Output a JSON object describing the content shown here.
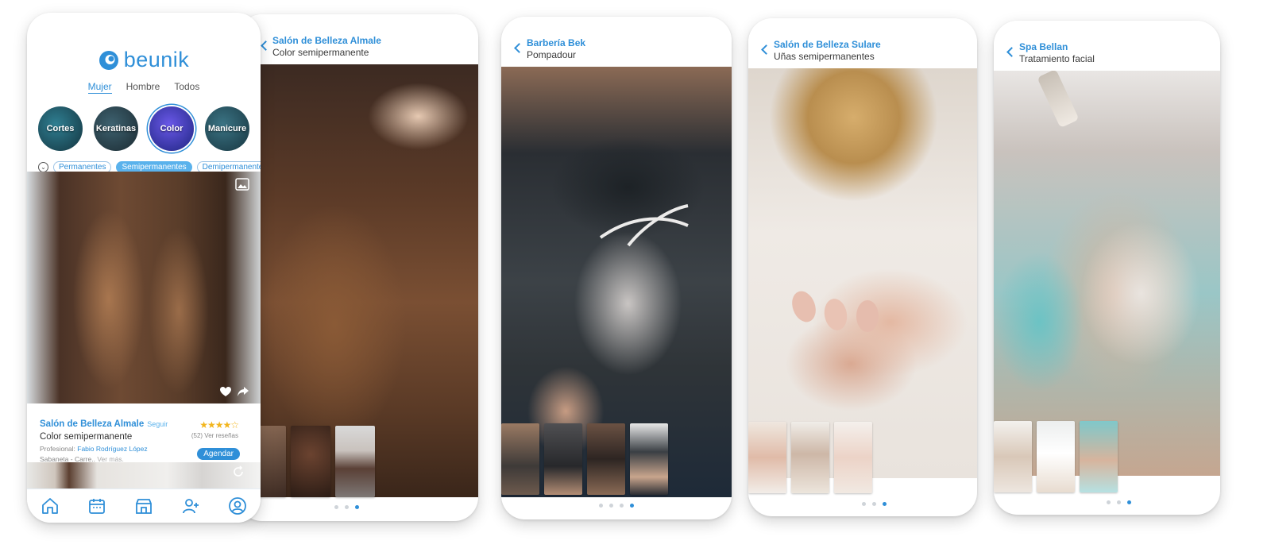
{
  "brand": {
    "name": "beunik"
  },
  "app": {
    "gender_tabs": [
      "Mujer",
      "Hombre",
      "Todos"
    ],
    "categories": [
      "Cortes",
      "Keratinas",
      "Color",
      "Manicure"
    ],
    "subcategories": [
      "Permanentes",
      "Semipermanentes",
      "Demipermanentes"
    ],
    "card": {
      "salon": "Salón de Belleza Almale",
      "follow": "Seguir",
      "service": "Color semipermanente",
      "professional_label": "Profesional:",
      "professional": "Fabio Rodríguez López",
      "location": "Sabaneta - Carre..",
      "see_more": "Ver más.",
      "rating": 4,
      "reviews": "(52) Ver reseñas",
      "book": "Agendar"
    },
    "nav": [
      "home-icon",
      "calendar-icon",
      "store-icon",
      "add-user-icon",
      "profile-icon"
    ]
  },
  "screens": [
    {
      "salon": "Salón de Belleza Almale",
      "service": "Color semipermanente",
      "dots": 3,
      "active": 2
    },
    {
      "salon": "Barbería Bek",
      "service": "Pompadour",
      "dots": 4,
      "active": 3
    },
    {
      "salon": "Salón de Belleza Sulare",
      "service": "Uñas semipermanentes",
      "dots": 3,
      "active": 2
    },
    {
      "salon": "Spa Bellan",
      "service": "Tratamiento facial",
      "dots": 3,
      "active": 2
    }
  ],
  "colors": {
    "accent": "#2f8fd8",
    "light_accent": "#5ab2ec",
    "star": "#f2b51d"
  }
}
